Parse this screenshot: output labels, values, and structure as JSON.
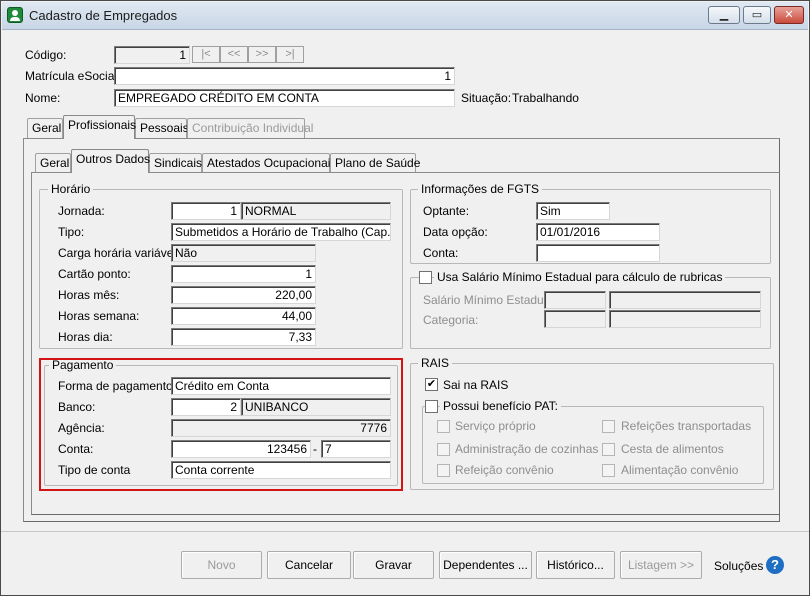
{
  "window": {
    "title": "Cadastro de Empregados",
    "minimize_label": "▁",
    "restore_label": "▭",
    "close_label": "✕"
  },
  "header": {
    "codigo_label": "Código:",
    "codigo_value": "1",
    "nav_first": "|<",
    "nav_prev": "<<",
    "nav_next": ">>",
    "nav_last": ">|",
    "matricula_label": "Matrícula eSocial:",
    "matricula_value": "1",
    "nome_label": "Nome:",
    "nome_value": "EMPREGADO CRÉDITO EM CONTA",
    "situacao_label": "Situação:",
    "situacao_value": "Trabalhando"
  },
  "main_tabs": [
    {
      "label": "Geral"
    },
    {
      "label": "Profissionais"
    },
    {
      "label": "Pessoais"
    },
    {
      "label": "Contribuição Individual"
    }
  ],
  "sub_tabs": [
    {
      "label": "Geral"
    },
    {
      "label": "Outros Dados"
    },
    {
      "label": "Sindicais"
    },
    {
      "label": "Atestados Ocupacionais"
    },
    {
      "label": "Plano de Saúde"
    }
  ],
  "horario": {
    "title": "Horário",
    "jornada_label": "Jornada:",
    "jornada_code": "1",
    "jornada_desc": "NORMAL",
    "tipo_label": "Tipo:",
    "tipo_value": "Submetidos a Horário de Trabalho (Cap. II da C",
    "carga_label": "Carga horária variável:",
    "carga_value": "Não",
    "cartao_label": "Cartão ponto:",
    "cartao_value": "1",
    "horas_mes_label": "Horas mês:",
    "horas_mes_value": "220,00",
    "horas_semana_label": "Horas semana:",
    "horas_semana_value": "44,00",
    "horas_dia_label": "Horas dia:",
    "horas_dia_value": "7,33"
  },
  "pagamento": {
    "title": "Pagamento",
    "forma_label": "Forma de pagamento:",
    "forma_value": "Crédito em Conta",
    "banco_label": "Banco:",
    "banco_code": "2",
    "banco_name": "UNIBANCO",
    "agencia_label": "Agência:",
    "agencia_value": "7776",
    "conta_label": "Conta:",
    "conta_number": "123456",
    "conta_sep": "-",
    "conta_digit": "7",
    "tipo_conta_label": "Tipo de conta",
    "tipo_conta_value": "Conta corrente"
  },
  "fgts": {
    "title": "Informações de FGTS",
    "optante_label": "Optante:",
    "optante_value": "Sim",
    "data_opcao_label": "Data opção:",
    "data_opcao_value": "01/01/2016",
    "conta_label": "Conta:",
    "conta_value": ""
  },
  "salario": {
    "checkbox_label": "Usa Salário Mínimo Estadual para cálculo de rubricas",
    "checked": false,
    "estadual_label": "Salário Mínimo Estadual:",
    "categoria_label": "Categoria:"
  },
  "rais": {
    "title": "RAIS",
    "sai_label": "Sai na RAIS",
    "sai_checked": true,
    "sai_mark": "✔",
    "pat_label": "Possui benefício PAT:",
    "pat_checked": false,
    "pat_options": [
      {
        "label": "Serviço próprio"
      },
      {
        "label": "Administração de cozinhas"
      },
      {
        "label": "Refeição convênio"
      },
      {
        "label": "Refeições transportadas"
      },
      {
        "label": "Cesta de alimentos"
      },
      {
        "label": "Alimentação convênio"
      }
    ]
  },
  "buttons": {
    "novo": "Novo",
    "cancelar": "Cancelar",
    "gravar": "Gravar",
    "dependentes": "Dependentes ...",
    "historico": "Histórico...",
    "listagem": "Listagem >>",
    "solucoes": "Soluções",
    "help_glyph": "?"
  },
  "colors": {
    "highlight": "#d21414",
    "help_icon": "#1e6fc4"
  }
}
